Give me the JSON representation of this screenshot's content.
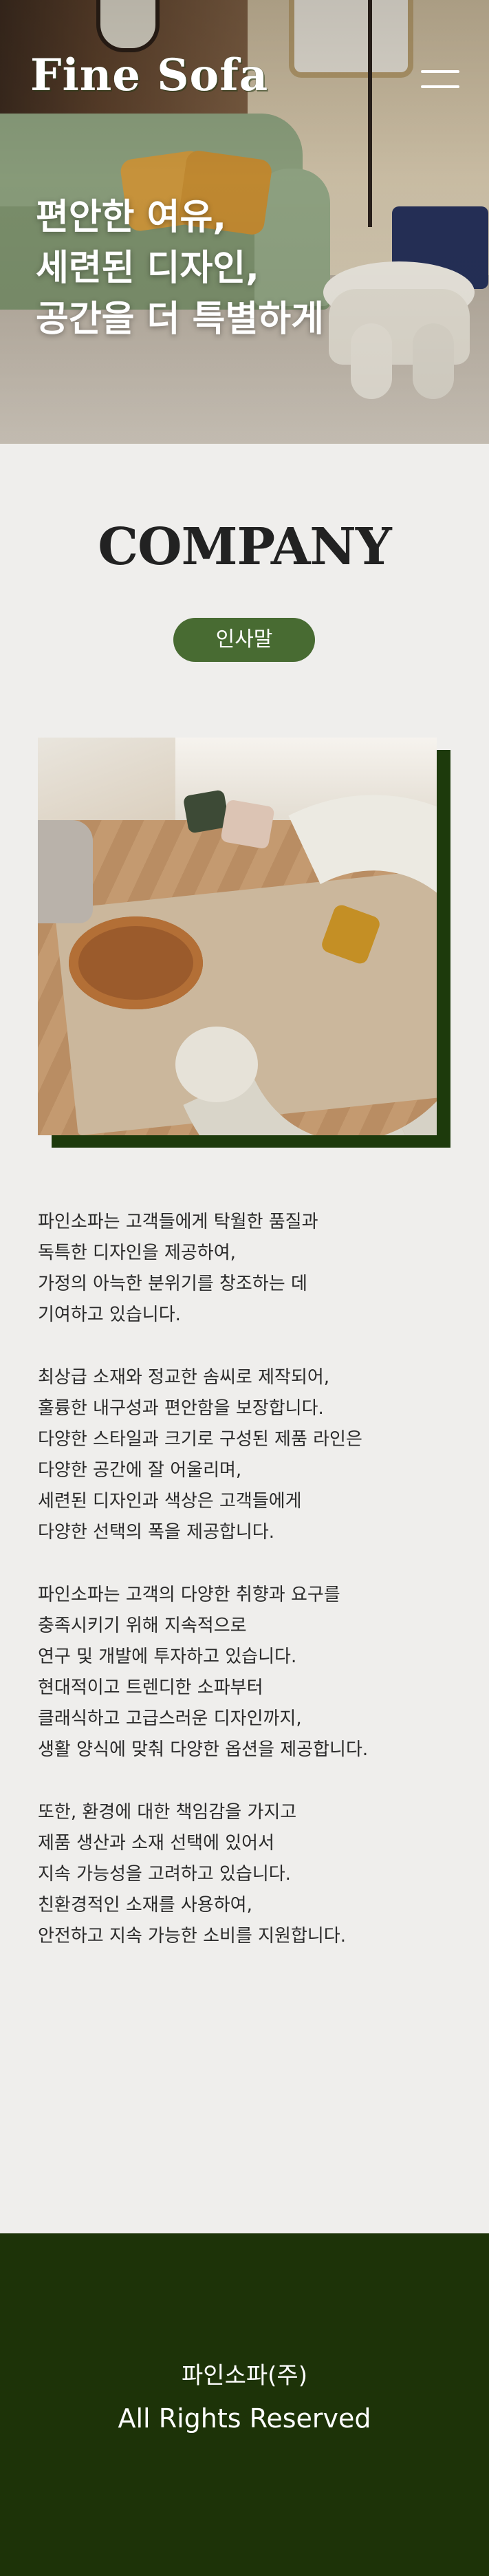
{
  "header": {
    "logo_text": "Fine Sofa",
    "menu_icon": "hamburger-menu-icon"
  },
  "hero": {
    "headline_lines": [
      "편안한 여유,",
      "세련된 디자인,",
      "공간을 더 특별하게"
    ]
  },
  "company": {
    "title": "COMPANY",
    "badge_label": "인사말"
  },
  "about": {
    "paragraphs": [
      [
        "파인소파는 고객들에게 탁월한 품질과",
        "독특한 디자인을 제공하여,",
        "가정의 아늑한 분위기를 창조하는 데",
        "기여하고 있습니다."
      ],
      [
        "최상급 소재와 정교한 솜씨로 제작되어,",
        "훌륭한 내구성과 편안함을 보장합니다.",
        "다양한 스타일과 크기로 구성된 제품 라인은",
        "다양한 공간에 잘 어울리며,",
        "세련된 디자인과 색상은 고객들에게",
        "다양한 선택의 폭을 제공합니다."
      ],
      [
        "파인소파는 고객의 다양한 취향과 요구를",
        "충족시키기 위해 지속적으로",
        "연구 및 개발에 투자하고 있습니다.",
        "현대적이고 트렌디한 소파부터",
        "클래식하고 고급스러운 디자인까지,",
        "생활 양식에 맞춰 다양한 옵션을 제공합니다."
      ],
      [
        "또한, 환경에 대한 책임감을 가지고",
        "제품 생산과 소재 선택에 있어서",
        "지속 가능성을 고려하고 있습니다.",
        "친환경적인 소재를 사용하여,",
        "안전하고 지속 가능한 소비를 지원합니다."
      ]
    ]
  },
  "footer": {
    "company_name": "파인소파(주)",
    "rights": "All Rights Reserved"
  },
  "colors": {
    "accent_green": "#486b32",
    "footer_green": "#1d3308",
    "photo_frame_green": "#1d3a0c",
    "background": "#efeeec"
  }
}
